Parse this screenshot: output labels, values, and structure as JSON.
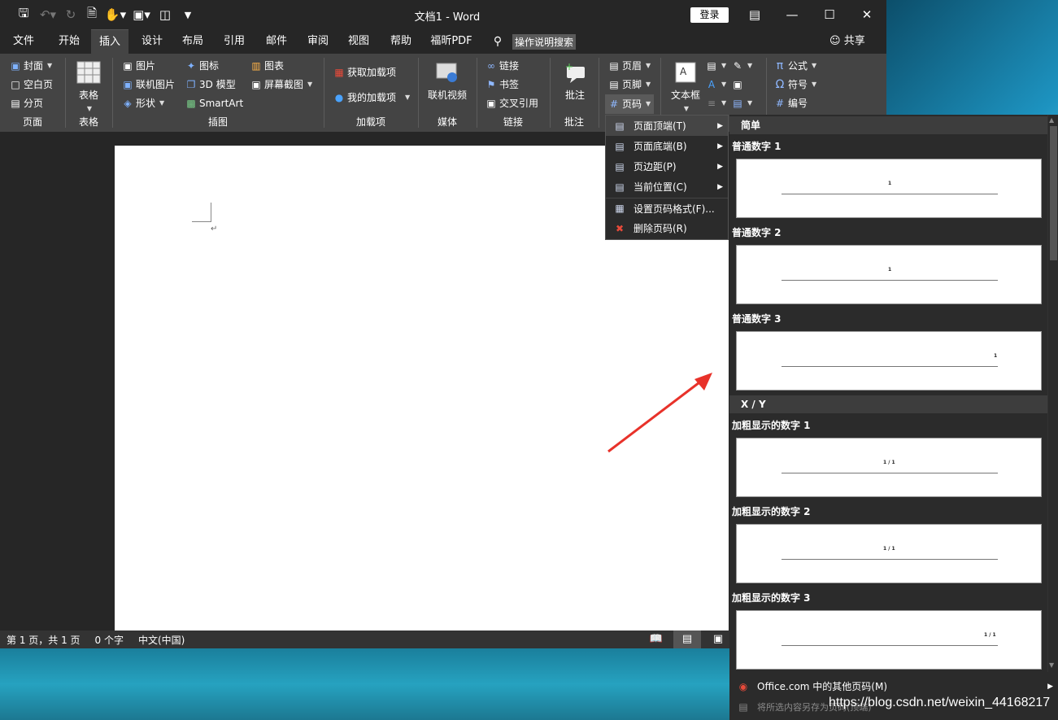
{
  "window": {
    "title": "文档1  -  Word",
    "login": "登录"
  },
  "qat": {
    "save_icon": "save-icon",
    "undo_icon": "undo-icon",
    "redo_icon": "redo-icon"
  },
  "tabs": [
    "文件",
    "开始",
    "插入",
    "设计",
    "布局",
    "引用",
    "邮件",
    "审阅",
    "视图",
    "帮助",
    "福昕PDF"
  ],
  "tellme": "操作说明搜索",
  "share": "共享",
  "ribbon": {
    "pages": {
      "cover": "封面",
      "blank": "空白页",
      "break": "分页",
      "label": "页面"
    },
    "table": {
      "table": "表格",
      "label": "表格"
    },
    "illus": {
      "picture": "图片",
      "online_picture": "联机图片",
      "shapes": "形状",
      "icons": "图标",
      "model3d": "3D 模型",
      "smartart": "SmartArt",
      "chart": "图表",
      "screenshot": "屏幕截图",
      "label": "插图"
    },
    "addins": {
      "get": "获取加载项",
      "mine": "我的加载项",
      "label": "加载项"
    },
    "media": {
      "video": "联机视频",
      "label": "媒体"
    },
    "links": {
      "link": "链接",
      "bookmark": "书签",
      "xref": "交叉引用",
      "label": "链接"
    },
    "comments": {
      "comment": "批注",
      "label": "批注"
    },
    "hf": {
      "header": "页眉",
      "footer": "页脚",
      "pagenum": "页码"
    },
    "text": {
      "textbox": "文本框"
    },
    "symbols": {
      "equation": "公式",
      "symbol": "符号",
      "number": "编号"
    }
  },
  "menu": [
    {
      "label": "页面顶端(T)",
      "icon": "page-top-icon",
      "submenu": true
    },
    {
      "label": "页面底端(B)",
      "icon": "page-bottom-icon",
      "submenu": true
    },
    {
      "label": "页边距(P)",
      "icon": "page-margin-icon",
      "submenu": true
    },
    {
      "label": "当前位置(C)",
      "icon": "current-position-icon",
      "submenu": true
    },
    {
      "label": "设置页码格式(F)...",
      "icon": "format-page-number-icon",
      "submenu": false
    },
    {
      "label": "删除页码(R)",
      "icon": "remove-page-number-icon",
      "submenu": false
    }
  ],
  "gallery": {
    "section1": "简单",
    "items1": [
      {
        "label": "普通数字 1",
        "num": "1"
      },
      {
        "label": "普通数字 2",
        "num": "1"
      },
      {
        "label": "普通数字 3",
        "num": "1"
      }
    ],
    "section2": "X / Y",
    "items2": [
      {
        "label": "加粗显示的数字 1",
        "num": "1 / 1"
      },
      {
        "label": "加粗显示的数字 2",
        "num": "1 / 1"
      },
      {
        "label": "加粗显示的数字 3",
        "num": "1 / 1"
      }
    ],
    "more": "Office.com 中的其他页码(M)",
    "save_selection": "将所选内容另存为页码(顶端)"
  },
  "status": {
    "page": "第 1 页，共 1 页",
    "words": "0 个字",
    "lang": "中文(中国)"
  },
  "watermark": "https://blog.csdn.net/weixin_44168217",
  "colors": {
    "arrow": "#e8322a",
    "ribbon": "#444444",
    "titlebar": "#262626"
  }
}
